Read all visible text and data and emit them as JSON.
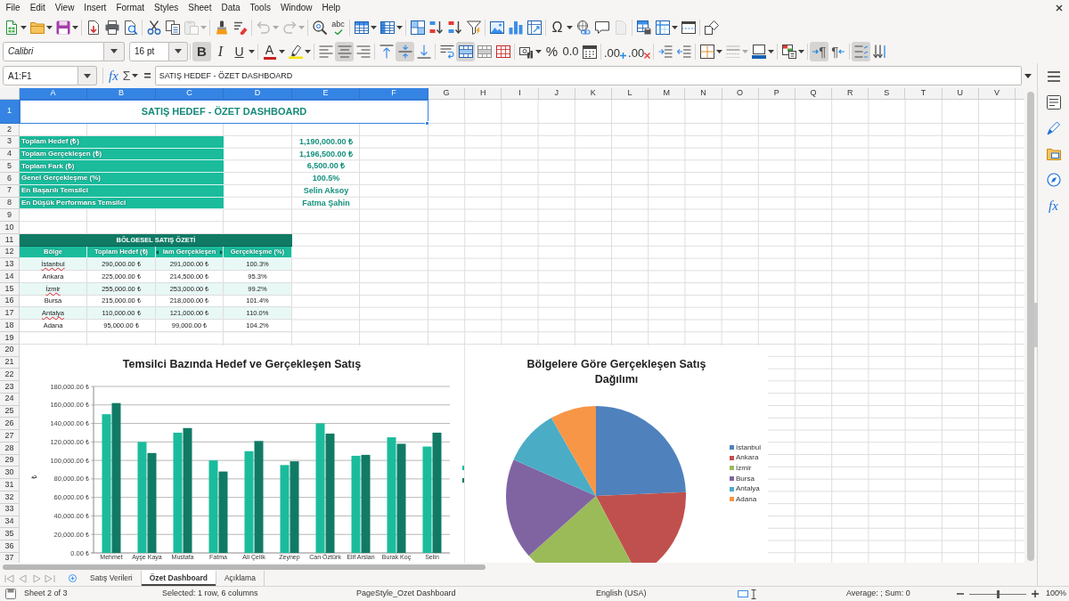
{
  "menu": [
    "File",
    "Edit",
    "View",
    "Insert",
    "Format",
    "Styles",
    "Sheet",
    "Data",
    "Tools",
    "Window",
    "Help"
  ],
  "toolbar_standard": [
    [
      {
        "disabled": false
      },
      {
        "disabled": false
      },
      {
        "disabled": false
      }
    ],
    [
      {
        "disabled": false
      },
      {
        "disabled": false
      },
      {
        "disabled": false
      }
    ],
    [
      {
        "disabled": false
      },
      {
        "disabled": false
      },
      {
        "disabled": true
      }
    ],
    [
      {
        "disabled": false
      },
      {
        "disabled": false
      }
    ],
    [
      {
        "disabled": true
      },
      {
        "disabled": true
      }
    ],
    [
      {
        "disabled": false
      },
      {
        "label": "abc",
        "disabled": false
      }
    ],
    [
      {
        "disabled": false
      },
      {
        "disabled": false
      }
    ],
    [
      {
        "disabled": false
      },
      {
        "disabled": false
      },
      {
        "disabled": false
      },
      {
        "disabled": false
      }
    ],
    [
      {
        "disabled": false
      },
      {
        "disabled": false
      },
      {
        "disabled": false
      }
    ],
    [
      {
        "label": "Ω",
        "disabled": false
      },
      {
        "disabled": false
      },
      {
        "disabled": false
      },
      {
        "disabled": true
      }
    ],
    [
      {
        "disabled": false
      },
      {
        "disabled": false
      },
      {
        "disabled": false
      }
    ],
    [
      {
        "disabled": false
      }
    ]
  ],
  "toolbar_formatting": {
    "font_name": "Calibri",
    "font_size": "16 pt",
    "groups": [
      [
        {
          "label": "B",
          "pressed": true,
          "disabled": false
        },
        {
          "label": "I",
          "pressed": false,
          "disabled": false
        },
        {
          "label": "U",
          "pressed": false,
          "disabled": false
        }
      ],
      [
        {
          "label": "A",
          "pressed": false,
          "disabled": false
        },
        {
          "pressed": false,
          "disabled": false
        }
      ],
      [
        {
          "pressed": false,
          "disabled": false
        },
        {
          "pressed": true,
          "disabled": false
        },
        {
          "pressed": false,
          "disabled": false
        }
      ],
      [
        {
          "pressed": false,
          "disabled": false
        },
        {
          "pressed": true,
          "disabled": false
        },
        {
          "pressed": false,
          "disabled": false
        }
      ],
      [
        {
          "pressed": false,
          "disabled": false
        },
        {
          "pressed": true,
          "disabled": false
        },
        {
          "pressed": false,
          "disabled": false
        },
        {
          "pressed": false,
          "disabled": false
        }
      ],
      [
        {
          "pressed": false,
          "disabled": false
        },
        {
          "label": "%",
          "pressed": false,
          "disabled": false
        },
        {
          "label": "0.0",
          "pressed": false,
          "disabled": false
        },
        {
          "pressed": false,
          "disabled": false
        }
      ],
      [
        {
          "label": ".00",
          "pressed": false,
          "disabled": false
        },
        {
          "label": ".00",
          "pressed": false,
          "disabled": false
        }
      ],
      [
        {
          "pressed": false,
          "disabled": false
        },
        {
          "pressed": false,
          "disabled": false
        }
      ],
      [
        {
          "pressed": false,
          "disabled": false
        },
        {
          "pressed": false,
          "disabled": true
        },
        {
          "pressed": false,
          "disabled": false
        }
      ],
      [
        {
          "pressed": false,
          "disabled": false
        }
      ],
      [
        {
          "label": "¶",
          "pressed": true,
          "disabled": false
        },
        {
          "label": "¶",
          "pressed": false,
          "disabled": false
        }
      ],
      [
        {
          "pressed": true,
          "disabled": false
        },
        {
          "pressed": false,
          "disabled": false
        }
      ]
    ]
  },
  "formula_bar": {
    "name_box": "A1:F1",
    "function_wizard": "fx",
    "sum": "Σ",
    "equals": "=",
    "content": "SATIŞ HEDEF - ÖZET DASHBOARD"
  },
  "sidebar": {
    "functions_tab": "fx"
  },
  "sheet": {
    "columns": [
      {
        "label": "A",
        "selected": true
      },
      {
        "label": "B",
        "selected": true
      },
      {
        "label": "C",
        "selected": true
      },
      {
        "label": "D",
        "selected": true
      },
      {
        "label": "E",
        "selected": true
      },
      {
        "label": "F",
        "selected": true
      },
      {
        "label": "G",
        "selected": false
      },
      {
        "label": "H",
        "selected": false
      },
      {
        "label": "I",
        "selected": false
      },
      {
        "label": "J",
        "selected": false
      },
      {
        "label": "K",
        "selected": false
      },
      {
        "label": "L",
        "selected": false
      },
      {
        "label": "M",
        "selected": false
      },
      {
        "label": "N",
        "selected": false
      },
      {
        "label": "O",
        "selected": false
      },
      {
        "label": "P",
        "selected": false
      },
      {
        "label": "Q",
        "selected": false
      },
      {
        "label": "R",
        "selected": false
      },
      {
        "label": "S",
        "selected": false
      },
      {
        "label": "T",
        "selected": false
      },
      {
        "label": "U",
        "selected": false
      },
      {
        "label": "V",
        "selected": false
      }
    ],
    "rows": [
      {
        "label": "1",
        "selected": true
      },
      {
        "label": "2",
        "selected": false
      },
      {
        "label": "3",
        "selected": false
      },
      {
        "label": "4",
        "selected": false
      },
      {
        "label": "5",
        "selected": false
      },
      {
        "label": "6",
        "selected": false
      },
      {
        "label": "7",
        "selected": false
      },
      {
        "label": "8",
        "selected": false
      },
      {
        "label": "9",
        "selected": false
      },
      {
        "label": "10",
        "selected": false
      },
      {
        "label": "11",
        "selected": false
      },
      {
        "label": "12",
        "selected": false
      },
      {
        "label": "13",
        "selected": false
      },
      {
        "label": "14",
        "selected": false
      },
      {
        "label": "15",
        "selected": false
      },
      {
        "label": "16",
        "selected": false
      },
      {
        "label": "17",
        "selected": false
      },
      {
        "label": "18",
        "selected": false
      },
      {
        "label": "19",
        "selected": false
      },
      {
        "label": "20",
        "selected": false
      },
      {
        "label": "21",
        "selected": false
      },
      {
        "label": "22",
        "selected": false
      },
      {
        "label": "23",
        "selected": false
      },
      {
        "label": "24",
        "selected": false
      },
      {
        "label": "25",
        "selected": false
      },
      {
        "label": "26",
        "selected": false
      },
      {
        "label": "27",
        "selected": false
      },
      {
        "label": "28",
        "selected": false
      },
      {
        "label": "29",
        "selected": false
      },
      {
        "label": "30",
        "selected": false
      },
      {
        "label": "31",
        "selected": false
      },
      {
        "label": "32",
        "selected": false
      },
      {
        "label": "33",
        "selected": false
      },
      {
        "label": "34",
        "selected": false
      },
      {
        "label": "35",
        "selected": false
      },
      {
        "label": "36",
        "selected": false
      },
      {
        "label": "37",
        "selected": false
      }
    ],
    "title": {
      "text": "SATIŞ HEDEF - ÖZET DASHBOARD",
      "selected": true
    },
    "summary": [
      {
        "label": "Toplam Hedef (₺)",
        "value": "1,190,000.00 ₺"
      },
      {
        "label": "Toplam Gerçekleşen (₺)",
        "value": "1,196,500.00 ₺"
      },
      {
        "label": "Toplam Fark (₺)",
        "value": "6,500.00 ₺"
      },
      {
        "label": "Genel Gerçekleşme (%)",
        "value": "100.5%"
      },
      {
        "label": "En Başarılı Temsilci",
        "value": "Selin Aksoy"
      },
      {
        "label": "En Düşük Performans Temsilci",
        "value": "Fatma Şahin"
      }
    ],
    "regional": {
      "title": "BÖLGESEL SATIŞ ÖZETİ",
      "headers": [
        {
          "text": "Bölge",
          "clipped": false
        },
        {
          "text": "Toplam Hedef (₺)",
          "clipped": false
        },
        {
          "text": "lam Gerçekleşen",
          "clipped": true
        },
        {
          "text": "Gerçekleşme (%)",
          "clipped": false
        }
      ],
      "rows": [
        {
          "cells": [
            "İstanbul",
            "290,000.00 ₺",
            "291,000.00 ₺",
            "100.3%"
          ],
          "misspelled": true
        },
        {
          "cells": [
            "Ankara",
            "225,000.00 ₺",
            "214,500.00 ₺",
            "95.3%"
          ],
          "misspelled": false
        },
        {
          "cells": [
            "İzmir",
            "255,000.00 ₺",
            "253,000.00 ₺",
            "99.2%"
          ],
          "misspelled": true
        },
        {
          "cells": [
            "Bursa",
            "215,000.00 ₺",
            "218,000.00 ₺",
            "101.4%"
          ],
          "misspelled": false
        },
        {
          "cells": [
            "Antalya",
            "110,000.00 ₺",
            "121,000.00 ₺",
            "110.0%"
          ],
          "misspelled": true
        },
        {
          "cells": [
            "Adana",
            "95,000.00 ₺",
            "99,000.00 ₺",
            "104.2%"
          ],
          "misspelled": false
        }
      ]
    }
  },
  "bar_chart": {
    "chart_data": {
      "type": "bar",
      "title": "Temsilci Bazında Hedef ve Gerçekleşen Satış",
      "ylabel": "₺",
      "grid": true,
      "categories": [
        "Mehmet",
        "Ayşe Kaya",
        "Mustafa",
        "Fatma",
        "Ali Çelik",
        "Zeynep",
        "Can Öztürk",
        "Elif Arslan",
        "Burak Koç",
        "Selin"
      ],
      "series": [
        {
          "color": "#1abc9c",
          "values": [
            150000,
            120000,
            130000,
            100000,
            110000,
            95000,
            140000,
            105000,
            125000,
            115000
          ]
        },
        {
          "color": "#117a65",
          "values": [
            162000,
            108000,
            135000,
            88000,
            121000,
            99000,
            129000,
            106000,
            118000,
            130000
          ]
        }
      ],
      "ylim": [
        0,
        180000
      ],
      "yticks": [
        {
          "value": 0,
          "label": "0.00 ₺"
        },
        {
          "value": 20000,
          "label": "20,000.00 ₺"
        },
        {
          "value": 40000,
          "label": "40,000.00 ₺"
        },
        {
          "value": 60000,
          "label": "60,000.00 ₺"
        },
        {
          "value": 80000,
          "label": "80,000.00 ₺"
        },
        {
          "value": 100000,
          "label": "100,000.00 ₺"
        },
        {
          "value": 120000,
          "label": "120,000.00 ₺"
        },
        {
          "value": 140000,
          "label": "140,000.00 ₺"
        },
        {
          "value": 160000,
          "label": "160,000.00 ₺"
        },
        {
          "value": 180000,
          "label": "180,000.00 ₺"
        }
      ]
    }
  },
  "pie_chart": {
    "chart_data": {
      "type": "pie",
      "title": "Bölgelere Göre Gerçekleşen Satış Dağılımı",
      "categories": [
        "İstanbul",
        "Ankara",
        "İzmir",
        "Bursa",
        "Antalya",
        "Adana"
      ],
      "values": [
        24.32,
        17.93,
        21.15,
        18.22,
        10.11,
        8.27
      ],
      "colors": [
        "#4f81bd",
        "#c0504d",
        "#9bbb59",
        "#8064a2",
        "#4bacc6",
        "#f79646"
      ],
      "legend": true
    }
  },
  "sheet_tabs": [
    {
      "label": "Satış Verileri",
      "selected": false
    },
    {
      "label": "Özet Dashboard",
      "selected": true
    },
    {
      "label": "Açıklama",
      "selected": false
    }
  ],
  "status_bar": {
    "sheet": "Sheet 2 of 3",
    "selection": "Selected: 1 row, 6 columns",
    "page_style": "PageStyle_Ozet Dashboard",
    "language": "English (USA)",
    "summary": "Average: ; Sum: 0",
    "zoom": {
      "level": 0.5,
      "reading": "100%"
    }
  }
}
